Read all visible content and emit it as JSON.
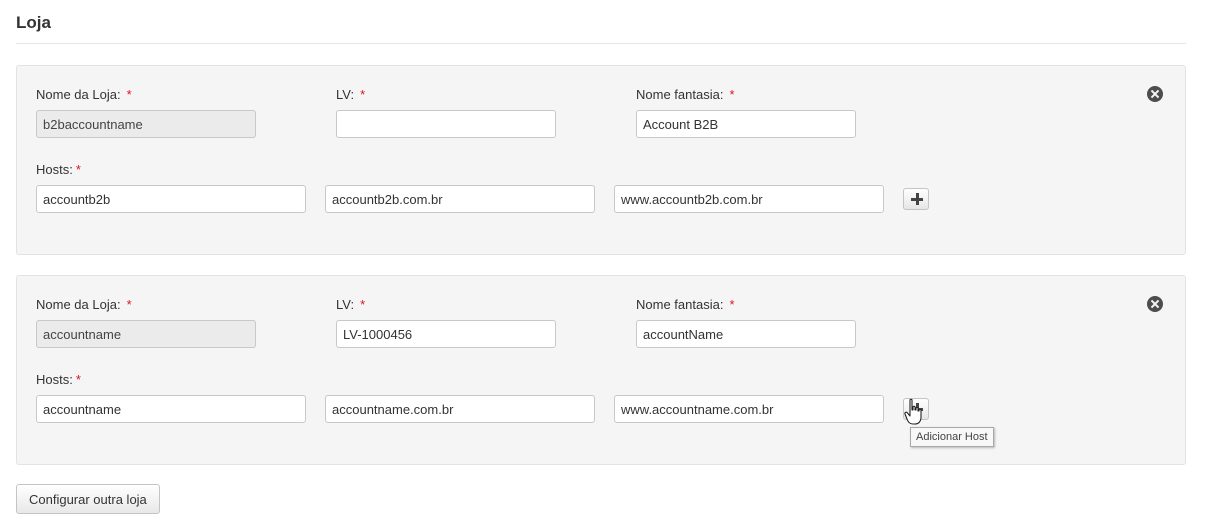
{
  "page": {
    "title": "Loja"
  },
  "stores": [
    {
      "labels": {
        "store_name": "Nome da Loja:",
        "lv": "LV:",
        "trade_name": "Nome fantasia:",
        "hosts": "Hosts:",
        "required": "*"
      },
      "store_name": "b2baccountname",
      "lv": "",
      "trade_name": "Account B2B",
      "hosts": [
        "accountb2b",
        "accountb2b.com.br",
        "www.accountb2b.com.br"
      ]
    },
    {
      "labels": {
        "store_name": "Nome da Loja:",
        "lv": "LV:",
        "trade_name": "Nome fantasia:",
        "hosts": "Hosts:",
        "required": "*"
      },
      "store_name": "accountname",
      "lv": "LV-1000456",
      "trade_name": "accountName",
      "hosts": [
        "accountname",
        "accountname.com.br",
        "www.accountname.com.br"
      ]
    }
  ],
  "tooltip": {
    "add_host": "Adicionar Host"
  },
  "actions": {
    "configure_another": "Configurar outra loja"
  },
  "icons": {
    "remove": "close-circle-icon",
    "add": "plus-icon",
    "cursor": "hand-pointer-icon"
  },
  "colors": {
    "required": "#d9141c",
    "panel_bg": "#f5f5f5",
    "readonly_bg": "#ebebeb"
  }
}
